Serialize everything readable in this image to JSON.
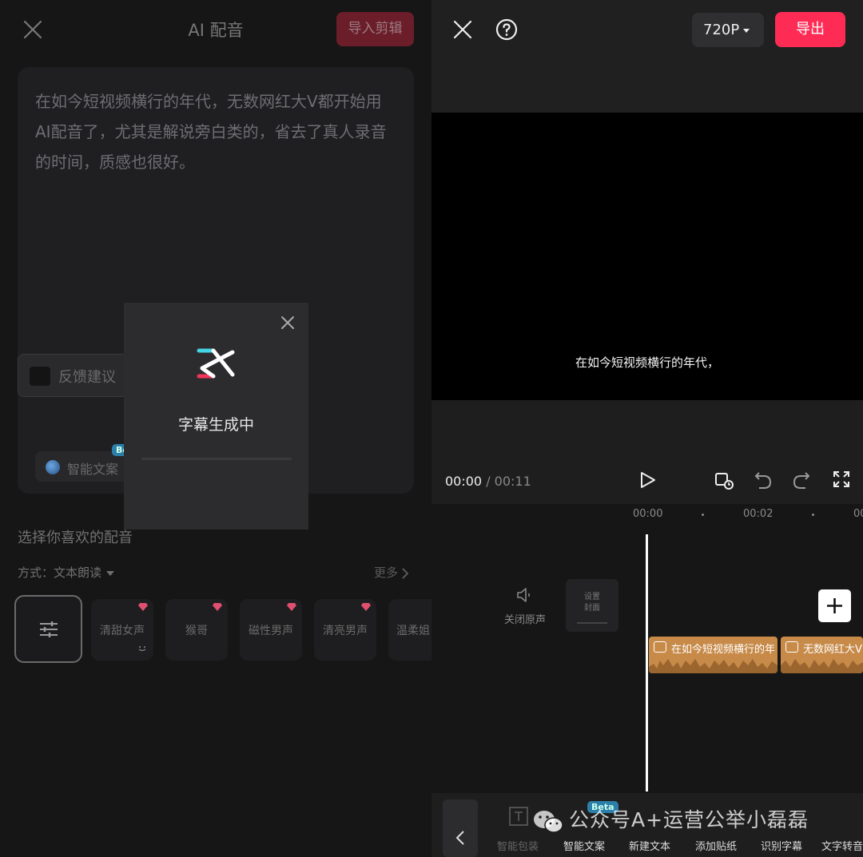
{
  "left": {
    "title": "AI 配音",
    "import_label": "导入剪辑",
    "text_body": "在如今短视频横行的年代，无数网红大V都开始用AI配音了，尤其是解说旁白类的，省去了真人录音的时间，质感也很好。",
    "feedback_label": "反馈建议",
    "smart_label": "智能文案",
    "beta": "Beta",
    "section_title": "选择你喜欢的配音",
    "mode_label": "方式：文本朗读",
    "more_label": "更多",
    "voices": [
      "清甜女声",
      "猴哥",
      "磁性男声",
      "清亮男声",
      "温柔姐"
    ]
  },
  "modal": {
    "text": "字幕生成中",
    "progress": 0
  },
  "right": {
    "resolution": "720P",
    "export_label": "导出",
    "subtitle": "在如今短视频横行的年代，",
    "time_current": "00:00",
    "time_sep": " / ",
    "time_total": "00:11",
    "ruler": [
      "00:00",
      "00:02",
      "00"
    ],
    "mute_label": "关闭原声",
    "cover_label_1": "设置",
    "cover_label_2": "封面",
    "clips": [
      "在如今短视频横行的年",
      "无数网红大V"
    ],
    "tools": [
      "智能包装",
      "智能文案",
      "新建文本",
      "添加贴纸",
      "识别字幕",
      "文字转音"
    ],
    "watermark": "公众号A+运营公举小磊磊"
  },
  "colors": {
    "accent": "#fe2c55",
    "clip": "#c78a48",
    "gem": "#e04f6f"
  }
}
